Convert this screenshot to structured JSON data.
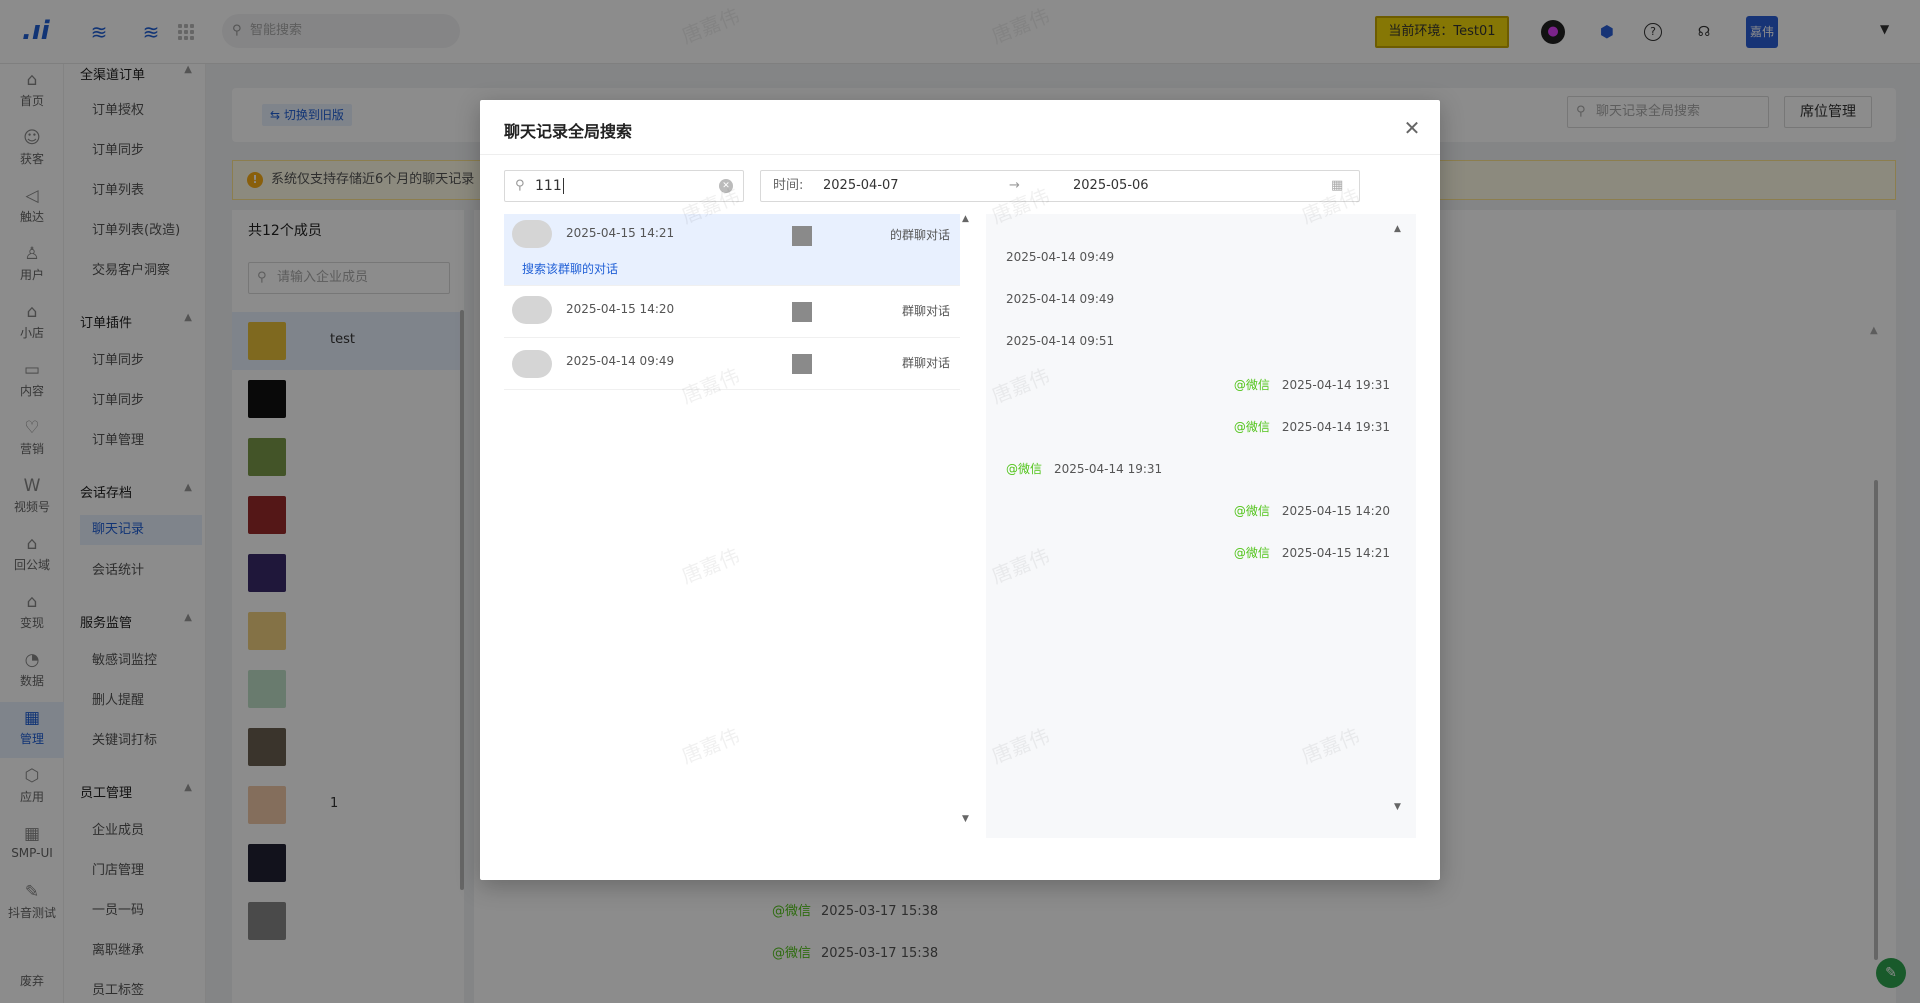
{
  "topbar": {
    "search_placeholder": "智能搜索",
    "env_label": "当前环境：Test01",
    "user_badge": "嘉伟",
    "help_icon": "?"
  },
  "rail": [
    {
      "label": "首页",
      "icon": "⌂"
    },
    {
      "label": "获客",
      "icon": "☺"
    },
    {
      "label": "触达",
      "icon": "◁"
    },
    {
      "label": "用户",
      "icon": "♙"
    },
    {
      "label": "小店",
      "icon": "⌂"
    },
    {
      "label": "内容",
      "icon": "▭"
    },
    {
      "label": "营销",
      "icon": "♡"
    },
    {
      "label": "视频号",
      "icon": "W"
    },
    {
      "label": "回公域",
      "icon": "⌂"
    },
    {
      "label": "变现",
      "icon": "⌂"
    },
    {
      "label": "数据",
      "icon": "◔"
    },
    {
      "label": "管理",
      "icon": "▦"
    },
    {
      "label": "应用",
      "icon": "⬡"
    },
    {
      "label": "SMP-UI",
      "icon": "▦"
    },
    {
      "label": "抖音测试",
      "icon": "✎"
    },
    {
      "label": "废弃",
      "icon": ""
    }
  ],
  "submenu": {
    "groups": [
      {
        "title": "全渠道订单",
        "items": [
          "订单授权",
          "订单同步",
          "订单列表",
          "订单列表(改造)",
          "交易客户洞察"
        ]
      },
      {
        "title": "订单插件",
        "items": [
          "订单同步",
          "订单同步",
          "订单管理"
        ]
      },
      {
        "title": "会话存档",
        "items": [
          "聊天记录",
          "会话统计"
        ]
      },
      {
        "title": "服务监管",
        "items": [
          "敏感词监控",
          "删人提醒",
          "关键词打标"
        ]
      },
      {
        "title": "员工管理",
        "items": [
          "企业成员",
          "门店管理",
          "一员一码",
          "离职继承",
          "员工标签"
        ]
      }
    ]
  },
  "page": {
    "switch_old": "⇆ 切换到旧版",
    "global_search_placeholder": "聊天记录全局搜索",
    "seat_button": "席位管理",
    "notice": "系统仅支持存储近6个月的聊天记录",
    "member_count": "共12个成员",
    "member_search_placeholder": "请输入企业成员",
    "first_member_name": "test",
    "member_suffixes": [
      "",
      "",
      "",
      "",
      "",
      "",
      "",
      "",
      "1",
      "",
      ""
    ],
    "bottom_lines": [
      {
        "tag": "@微信",
        "time": "2025-03-17 15:38"
      },
      {
        "tag": "@微信",
        "time": "2025-03-17 15:38"
      }
    ]
  },
  "modal": {
    "title": "聊天记录全局搜索",
    "keyword": "111",
    "time_label": "时间:",
    "date_start": "2025-04-07",
    "date_sep": "→",
    "date_end": "2025-05-06",
    "results": [
      {
        "time": "2025-04-15 14:21",
        "type": "的群聊对话",
        "link": "搜索该群聊的对话"
      },
      {
        "time": "2025-04-15 14:20",
        "type": "群聊对话"
      },
      {
        "time": "2025-04-14 09:49",
        "type": "群聊对话"
      }
    ],
    "messages": [
      {
        "side": "left",
        "tag": "",
        "time": "2025-04-14 09:49"
      },
      {
        "side": "left",
        "tag": "",
        "time": "2025-04-14 09:49"
      },
      {
        "side": "left",
        "tag": "",
        "time": "2025-04-14 09:51"
      },
      {
        "side": "right",
        "tag": "@微信",
        "time": "2025-04-14 19:31"
      },
      {
        "side": "right",
        "tag": "@微信",
        "time": "2025-04-14 19:31"
      },
      {
        "side": "left",
        "tag": "@微信",
        "time": "2025-04-14 19:31"
      },
      {
        "side": "right",
        "tag": "@微信",
        "time": "2025-04-15 14:20"
      },
      {
        "side": "right",
        "tag": "@微信",
        "time": "2025-04-15 14:21"
      }
    ]
  },
  "watermark": "唐嘉伟",
  "colors": {
    "accent": "#1f5fd6",
    "wechat_green": "#52c41a",
    "env_yellow": "#f5d90a"
  }
}
